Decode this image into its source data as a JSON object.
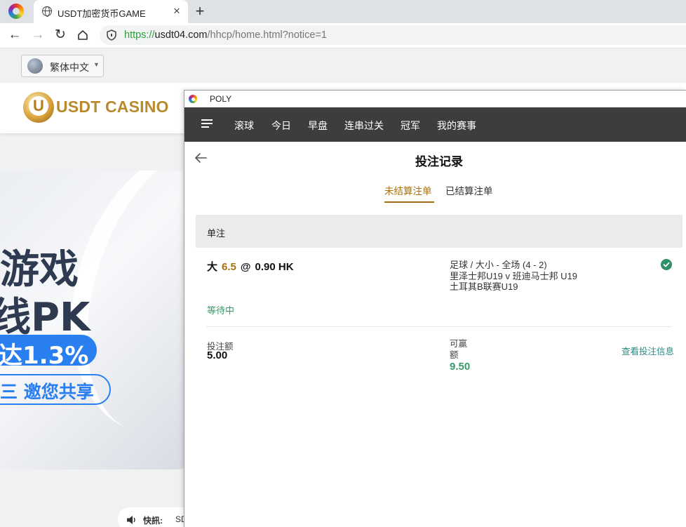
{
  "browser": {
    "tab_title": "USDT加密货币GAME",
    "tab_close": "×",
    "new_tab": "+",
    "url_scheme": "https://",
    "url_host": "usdt04.com",
    "url_path": "/hhcp/home.html?notice=1",
    "nav": {
      "back": "←",
      "forward": "→",
      "reload": "↻"
    }
  },
  "site": {
    "language": "繁体中文",
    "brand": "USDT CASINO",
    "banner": {
      "line1": "游戏",
      "line2": "线PK",
      "pill1": "达1.3%",
      "pill2": "三 邀您共享"
    },
    "ticker_label": "快訊:",
    "ticker_text": "SD"
  },
  "popup": {
    "window_title": "POLY",
    "nav_items": [
      "滚球",
      "今日",
      "早盘",
      "连串过关",
      "冠军",
      "我的赛事"
    ],
    "page_title": "投注记录",
    "subtabs": {
      "unsettled": "未结算注单",
      "settled": "已结算注单"
    },
    "section": "单注",
    "bet": {
      "selection": "大",
      "line": "6.5",
      "at": "@",
      "odds": "0.90 HK",
      "market": "足球 / 大小 - 全场 (4 - 2)",
      "teams": "里泽士邦U19 v 班迪马士邦 U19",
      "league": "土耳其B联赛U19",
      "status": "等待中",
      "stake_label": "投注额",
      "stake_value": "5.00",
      "win_label": "可赢额",
      "win_value": "9.50",
      "view_link": "查看投注信息"
    }
  },
  "colors": {
    "accent_gold": "#a8700f",
    "success_green": "#3a9a6a",
    "nav_dark": "#3d3d3d",
    "banner_blue": "#2a7ff0"
  }
}
